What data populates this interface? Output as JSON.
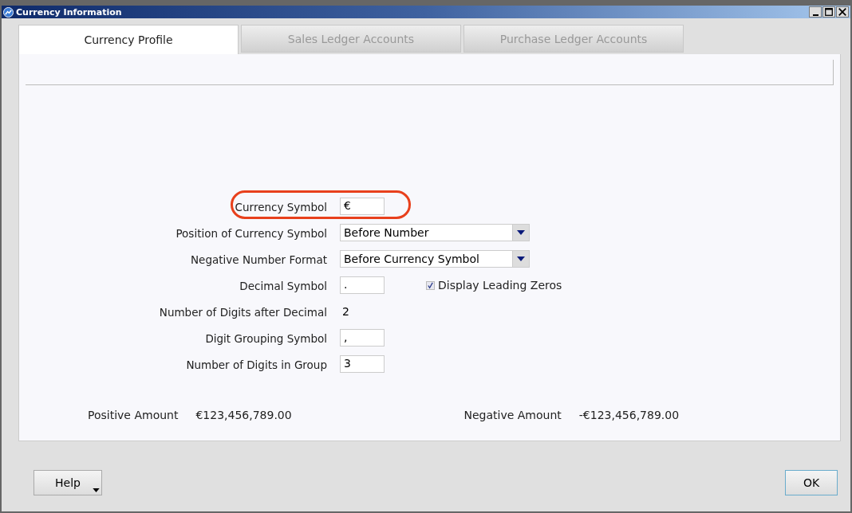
{
  "window": {
    "title": "Currency Information"
  },
  "tabs": [
    {
      "label": "Currency Profile",
      "selected": true
    },
    {
      "label": "Sales Ledger Accounts",
      "selected": false
    },
    {
      "label": "Purchase Ledger Accounts",
      "selected": false
    }
  ],
  "fields": [
    {
      "label": "Currency Symbol",
      "kind": "text",
      "value": "€",
      "highlighted": true
    },
    {
      "label": "Position of Currency Symbol",
      "kind": "select",
      "value": "Before Number",
      "highlighted": false
    },
    {
      "label": "Negative Number Format",
      "kind": "select",
      "value": "Before Currency Symbol",
      "highlighted": false
    },
    {
      "label": "Decimal Symbol",
      "kind": "text",
      "value": ".",
      "highlighted": false,
      "checkbox": {
        "label": "Display Leading Zeros",
        "checked": true
      }
    },
    {
      "label": "Number of Digits after Decimal",
      "kind": "value",
      "value": "2",
      "highlighted": false
    },
    {
      "label": "Digit Grouping Symbol",
      "kind": "text",
      "value": ",",
      "highlighted": false
    },
    {
      "label": "Number of Digits in Group",
      "kind": "text",
      "value": "3",
      "highlighted": false
    }
  ],
  "amounts": [
    {
      "label": "Positive Amount",
      "value": "€123,456,789.00"
    },
    {
      "label": "Negative Amount",
      "value": "-€123,456,789.00"
    }
  ],
  "buttons": {
    "help": "Help",
    "ok": "OK"
  }
}
